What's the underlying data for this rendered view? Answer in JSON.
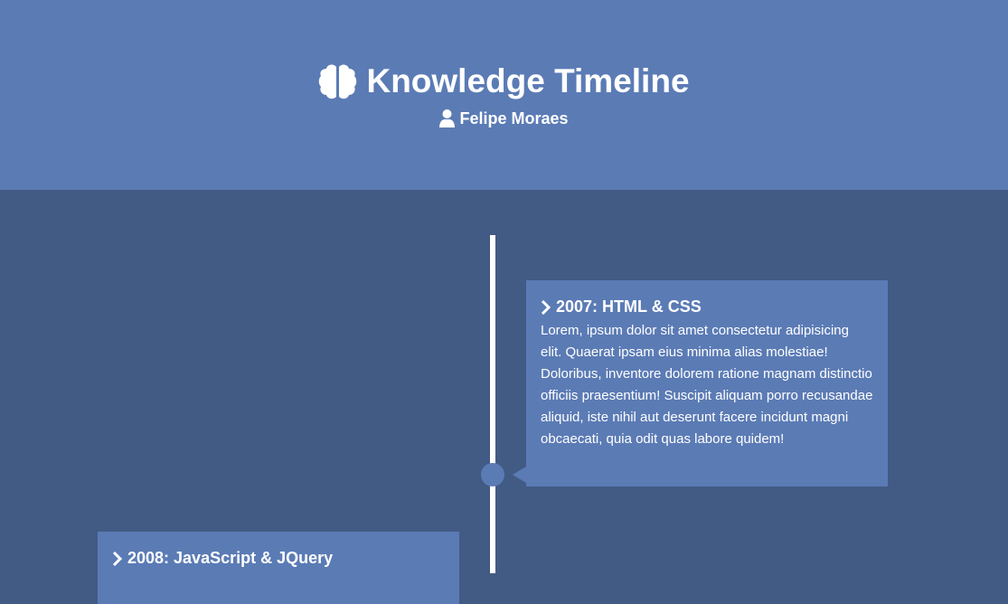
{
  "header": {
    "title": "Knowledge Timeline",
    "title_icon": "brain-icon",
    "author": "Felipe Moraes",
    "author_icon": "user-icon"
  },
  "timeline": {
    "entries": [
      {
        "title": "2007: HTML & CSS",
        "icon": "chevron-right-icon",
        "side": "right",
        "body": "Lorem, ipsum dolor sit amet consectetur adipisicing elit. Quaerat ipsam eius minima alias molestiae! Doloribus, inventore dolorem ratione magnam distinctio officiis praesentium! Suscipit aliquam porro recusandae aliquid, iste nihil aut deserunt facere incidunt magni obcaecati, quia odit quas labore quidem!"
      },
      {
        "title": "2008: JavaScript & JQuery",
        "icon": "chevron-right-icon",
        "side": "left",
        "body": ""
      }
    ]
  },
  "colors": {
    "header_bg": "#5b7bb5",
    "page_bg": "#425b85",
    "card_bg": "#5b7bb5",
    "line": "#ffffff",
    "text": "#ffffff"
  }
}
